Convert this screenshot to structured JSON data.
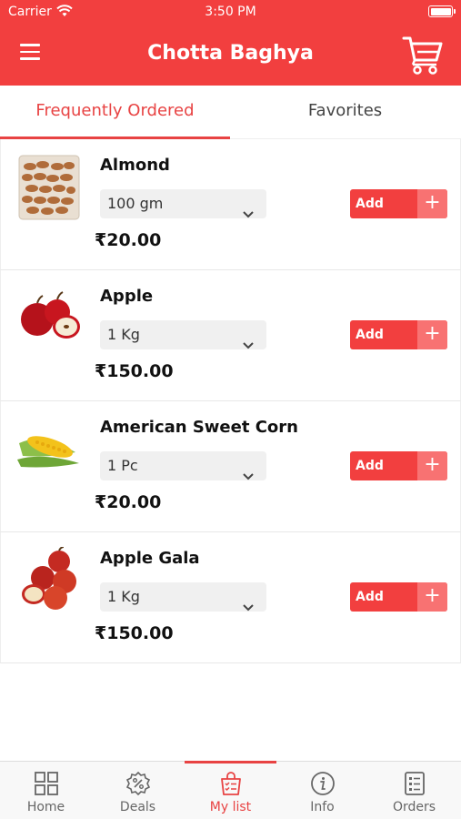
{
  "status_bar": {
    "carrier": "Carrier",
    "time": "3:50 PM"
  },
  "header": {
    "title": "Chotta Baghya",
    "menu_icon": "hamburger-menu-icon",
    "cart_icon": "shopping-cart-icon"
  },
  "tabs": [
    {
      "label": "Frequently Ordered",
      "active": true
    },
    {
      "label": "Favorites",
      "active": false
    }
  ],
  "products": [
    {
      "name": "Almond",
      "quantity": "100 gm",
      "price": "₹20.00",
      "add_label": "Add",
      "image": "almond-image"
    },
    {
      "name": "Apple",
      "quantity": "1 Kg",
      "price": "₹150.00",
      "add_label": "Add",
      "image": "apple-image"
    },
    {
      "name": "American Sweet Corn",
      "quantity": "1 Pc",
      "price": "₹20.00",
      "add_label": "Add",
      "image": "corn-image"
    },
    {
      "name": "Apple Gala",
      "quantity": "1 Kg",
      "price": "₹150.00",
      "add_label": "Add",
      "image": "apple-gala-image"
    }
  ],
  "bottom_nav": [
    {
      "label": "Home",
      "icon": "grid-icon",
      "active": false
    },
    {
      "label": "Deals",
      "icon": "percent-badge-icon",
      "active": false
    },
    {
      "label": "My list",
      "icon": "shopping-list-icon",
      "active": true
    },
    {
      "label": "Info",
      "icon": "info-icon",
      "active": false
    },
    {
      "label": "Orders",
      "icon": "orders-list-icon",
      "active": false
    }
  ],
  "colors": {
    "brand_red": "#f23f3f",
    "plus_red": "#f87272",
    "active_tab": "#e84343"
  }
}
